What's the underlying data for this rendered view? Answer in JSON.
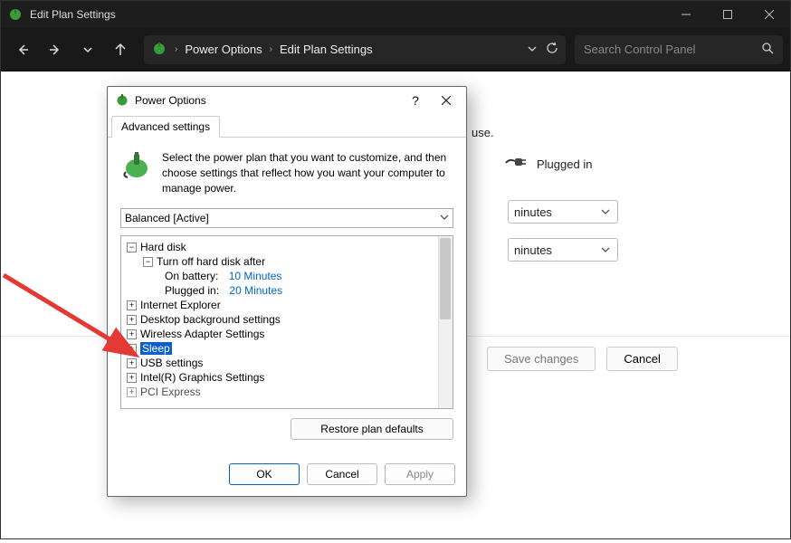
{
  "titlebar": {
    "title": "Edit Plan Settings"
  },
  "toolbar": {
    "breadcrumb1": "Power Options",
    "breadcrumb2": "Edit Plan Settings"
  },
  "search": {
    "placeholder": "Search Control Panel"
  },
  "background": {
    "partial_text": "use.",
    "plugged_in": "Plugged in",
    "minutes1": "ninutes",
    "minutes2": "ninutes"
  },
  "footer": {
    "save": "Save changes",
    "cancel": "Cancel"
  },
  "modal": {
    "title": "Power Options",
    "tab": "Advanced settings",
    "intro": "Select the power plan that you want to customize, and then choose settings that reflect how you want your computer to manage power.",
    "plan": "Balanced [Active]",
    "tree": {
      "hard_disk": "Hard disk",
      "turn_off": "Turn off hard disk after",
      "on_battery_label": "On battery:",
      "on_battery_value": "10 Minutes",
      "plugged_in_label": "Plugged in:",
      "plugged_in_value": "20 Minutes",
      "ie": "Internet Explorer",
      "desktop_bg": "Desktop background settings",
      "wireless": "Wireless Adapter Settings",
      "sleep": "Sleep",
      "usb": "USB settings",
      "intel": "Intel(R) Graphics Settings",
      "pci": "PCI Express"
    },
    "restore": "Restore plan defaults",
    "ok": "OK",
    "cancel": "Cancel",
    "apply": "Apply"
  }
}
